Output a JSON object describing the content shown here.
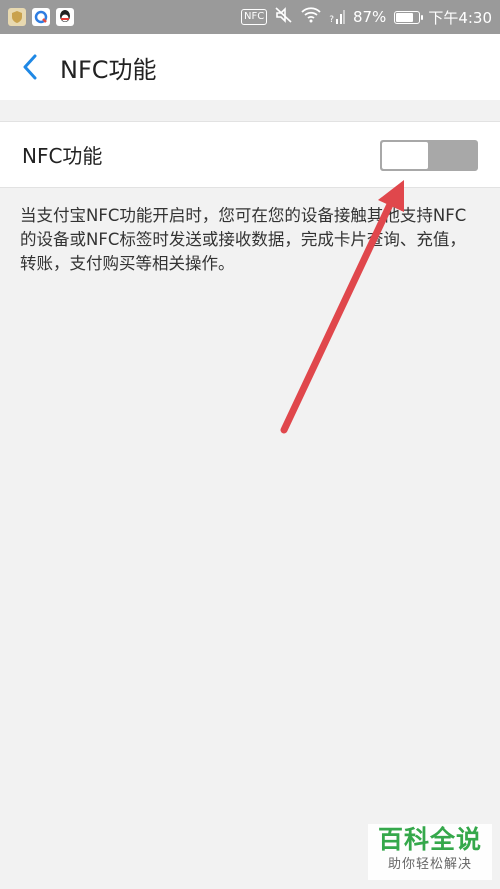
{
  "status_bar": {
    "nfc_label": "NFC",
    "signal_label": "?",
    "battery_percent": "87%",
    "battery_level": 0.87,
    "time": "下午4:30",
    "icons": [
      "shield-app-icon",
      "browser-app-icon",
      "qq-app-icon",
      "nfc-icon",
      "mute-icon",
      "wifi-icon",
      "signal-icon",
      "battery-icon"
    ]
  },
  "header": {
    "title": "NFC功能",
    "back_icon": "chevron-left-icon"
  },
  "setting": {
    "label": "NFC功能",
    "toggle_on": false
  },
  "description": "当支付宝NFC功能开启时，您可在您的设备接触其他支持NFC的设备或NFC标签时发送或接收数据，完成卡片查询、充值，转账，支付购买等相关操作。",
  "watermark": {
    "title": "百科全说",
    "subtitle": "助你轻松解决"
  },
  "colors": {
    "accent": "#1f88e5",
    "status_bar": "#9a9a9a",
    "annotation_arrow": "#e0474c",
    "watermark_green": "#35a84b"
  }
}
